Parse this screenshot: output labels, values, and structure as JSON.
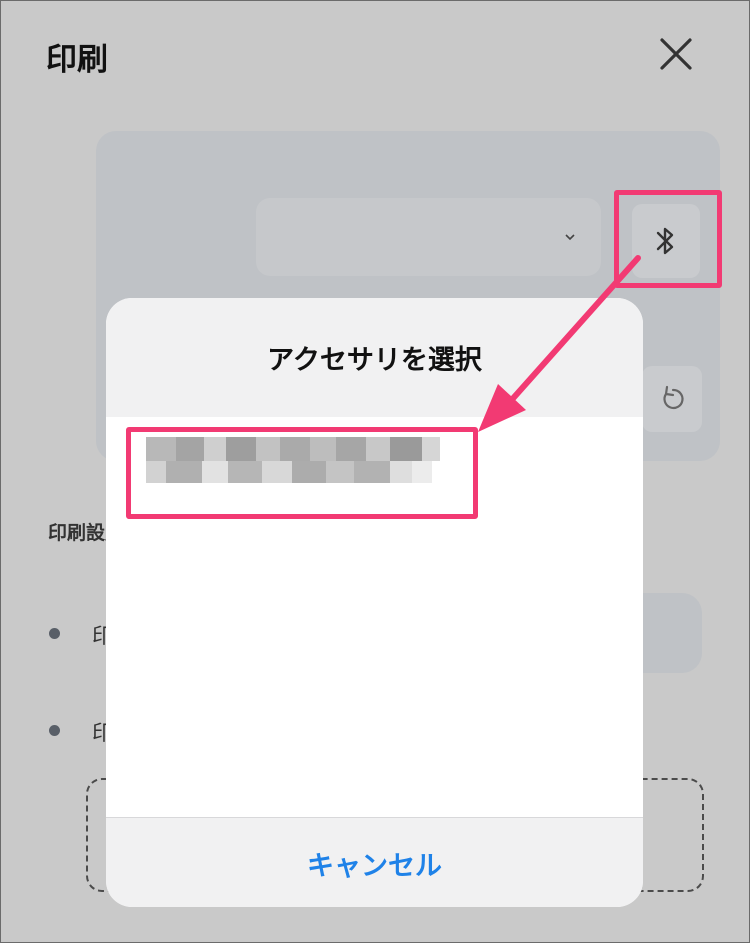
{
  "header": {
    "title": "印刷"
  },
  "form": {
    "section_label": "印刷設定",
    "bullet_items": [
      "印刷",
      "印刷"
    ]
  },
  "picker": {
    "title": "アクセサリを選択",
    "device_name": "",
    "cancel_label": "キャンセル"
  },
  "colors": {
    "accent": "#1f82e8",
    "annotation": "#f23a73"
  },
  "icons": [
    "close-icon",
    "chevron-down-icon",
    "bluetooth-icon",
    "refresh-icon",
    "bullet-dot"
  ]
}
